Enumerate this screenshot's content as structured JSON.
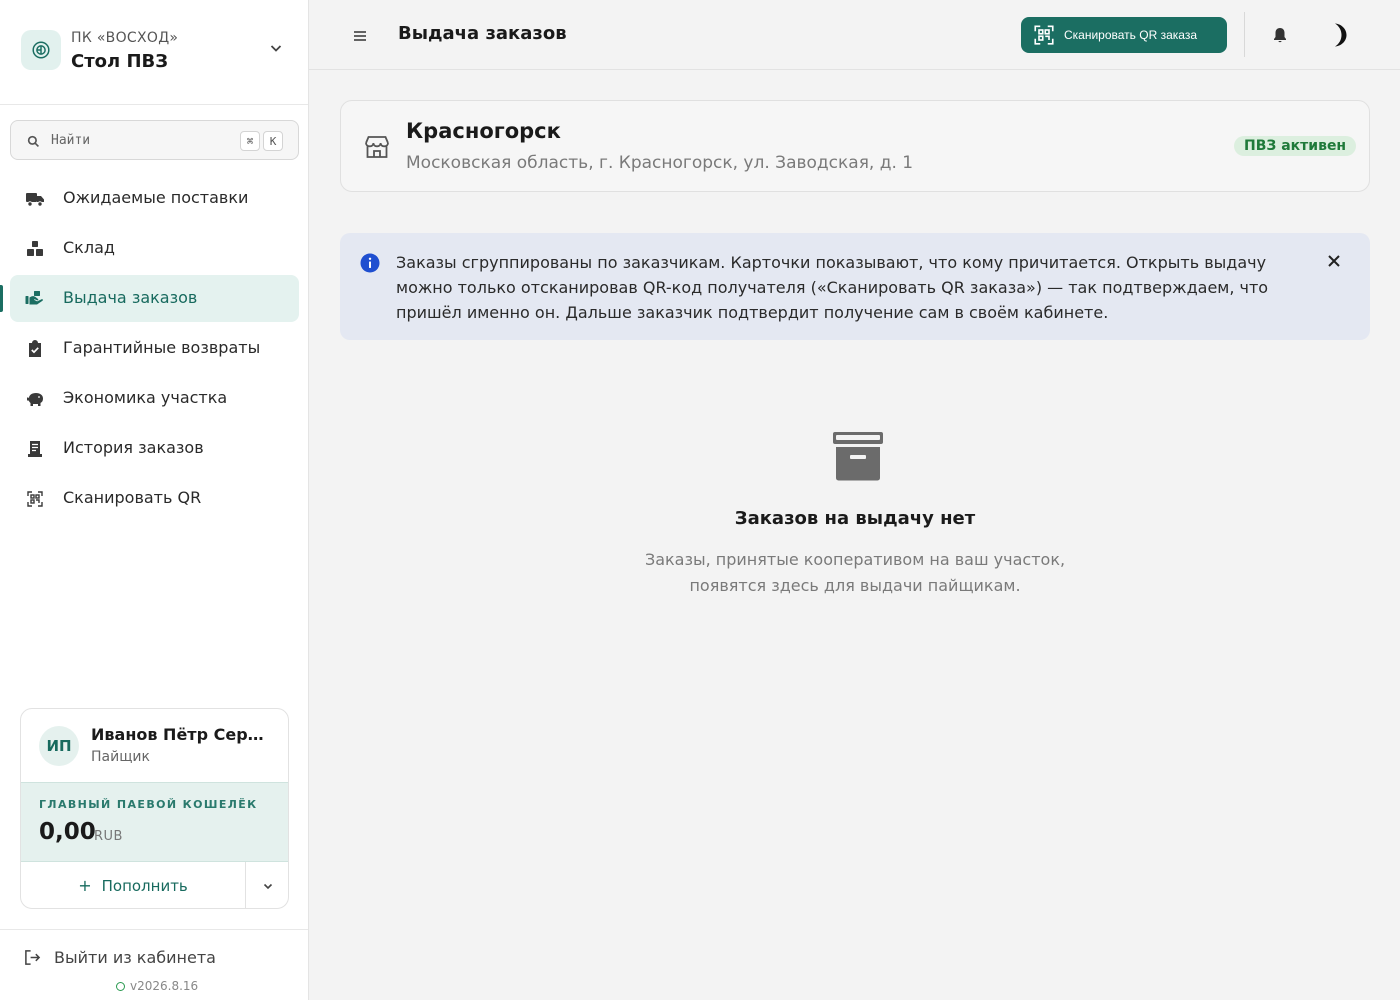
{
  "sidebar": {
    "org": {
      "subtitle": "ПК «ВОСХОД»",
      "name": "Стол ПВЗ"
    },
    "search": {
      "placeholder": "Найти",
      "shortcut_mod": "⌘",
      "shortcut_key": "K"
    },
    "nav": [
      {
        "label": "Ожидаемые поставки",
        "icon": "truck-icon",
        "active": false
      },
      {
        "label": "Склад",
        "icon": "boxes-icon",
        "active": false
      },
      {
        "label": "Выдача заказов",
        "icon": "hand-box-icon",
        "active": true
      },
      {
        "label": "Гарантийные возвраты",
        "icon": "clipboard-check-icon",
        "active": false
      },
      {
        "label": "Экономика участка",
        "icon": "piggy-bank-icon",
        "active": false
      },
      {
        "label": "История заказов",
        "icon": "receipt-icon",
        "active": false
      },
      {
        "label": "Сканировать QR",
        "icon": "qr-scan-icon",
        "active": false
      }
    ],
    "user": {
      "initials": "ИП",
      "name": "Иванов Пётр Сергеевич",
      "role": "Пайщик"
    },
    "wallet": {
      "label": "ГЛАВНЫЙ ПАЕВОЙ КОШЕЛЁК",
      "amount": "0,00",
      "currency": "RUB"
    },
    "topup_label": "Пополнить",
    "logout_label": "Выйти из кабинета",
    "version": "v2026.8.16"
  },
  "header": {
    "title": "Выдача заказов",
    "scan_button": "Сканировать QR заказа"
  },
  "pvz": {
    "city": "Красногорск",
    "address": "Московская область, г. Красногорск, ул. Заводская, д. 1",
    "status": "ПВЗ активен"
  },
  "info": {
    "text": "Заказы сгруппированы по заказчикам. Карточки показывают, что кому причитается. Открыть выдачу можно только отсканировав QR-код получателя («Сканировать QR заказа») — так подтверждаем, что пришёл именно он. Дальше заказчик подтвердит получение сам в своём кабинете."
  },
  "empty": {
    "title": "Заказов на выдачу нет",
    "text": "Заказы, принятые кооперативом на ваш участок, появятся здесь для выдачи пайщикам."
  },
  "colors": {
    "accent": "#1b6e62",
    "accent_bg": "#e4f2ef",
    "info_bg": "#e4e8f2",
    "badge_bg": "#dcefdf",
    "badge_fg": "#1f7a3a"
  }
}
